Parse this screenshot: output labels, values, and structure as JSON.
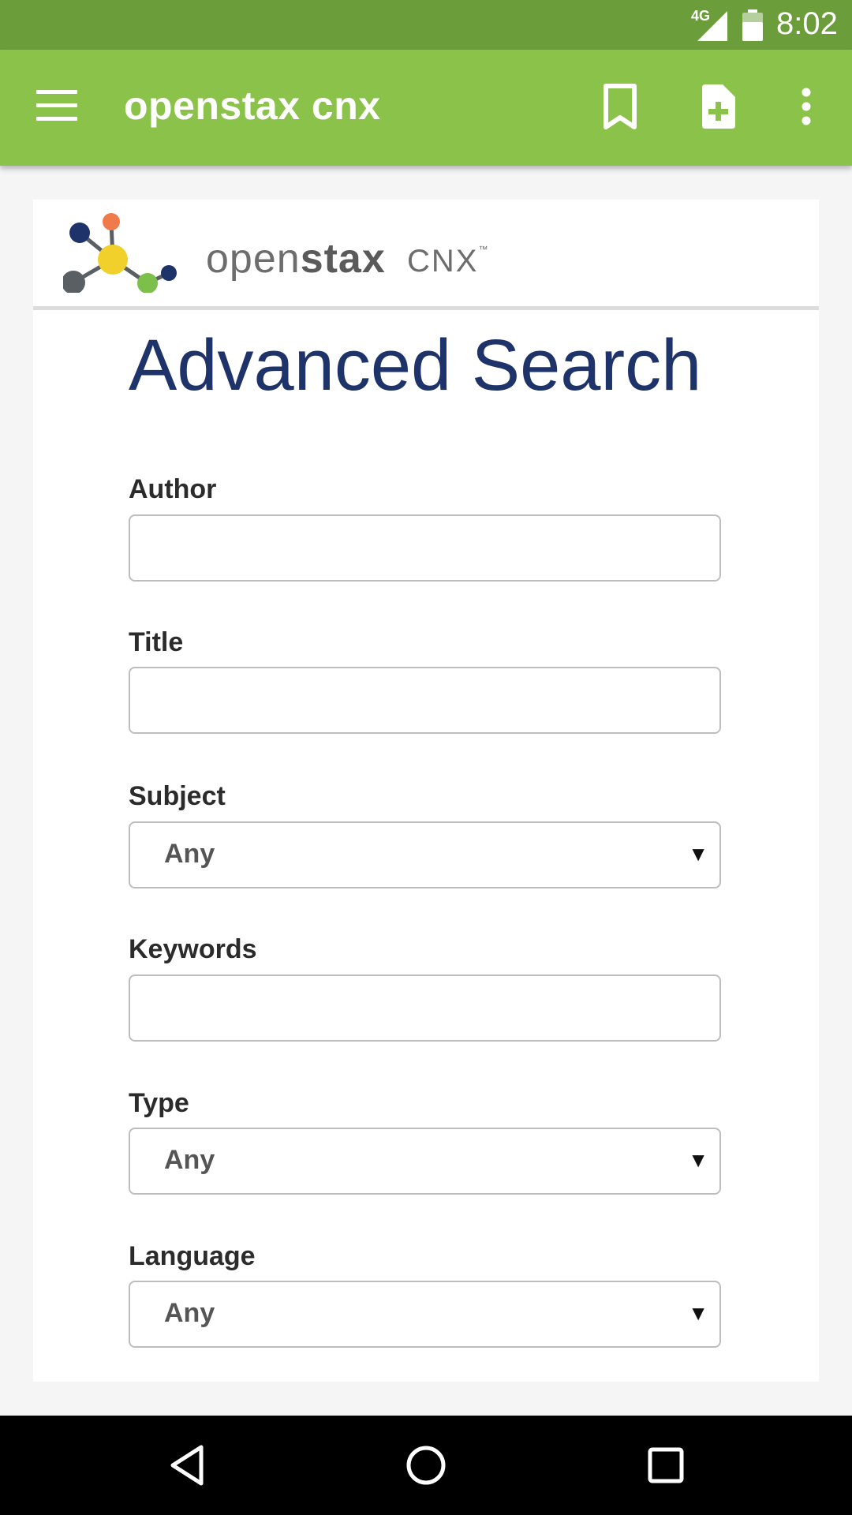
{
  "status_bar": {
    "network": "4G",
    "time": "8:02"
  },
  "app_bar": {
    "title": "openstax cnx",
    "icons": [
      "menu-icon",
      "bookmark-icon",
      "add-document-icon",
      "more-vert-icon"
    ]
  },
  "logo": {
    "brand_light": "open",
    "brand_bold": "stax",
    "product": "CNX",
    "tm": "™"
  },
  "page": {
    "title": "Advanced Search"
  },
  "form": {
    "author": {
      "label": "Author",
      "value": ""
    },
    "title": {
      "label": "Title",
      "value": ""
    },
    "subject": {
      "label": "Subject",
      "value": "Any"
    },
    "keywords": {
      "label": "Keywords",
      "value": ""
    },
    "type": {
      "label": "Type",
      "value": "Any"
    },
    "language": {
      "label": "Language",
      "value": "Any"
    },
    "dropdown_caret": "▼"
  },
  "nav_bar": {
    "icons": [
      "back-icon",
      "home-icon",
      "recents-icon"
    ]
  },
  "colors": {
    "status_bar": "#6b9e3a",
    "app_bar": "#8bc34a",
    "title_blue": "#1e3369",
    "logo_navy": "#1e3369",
    "logo_orange": "#f07a4a",
    "logo_yellow": "#f2d02c",
    "logo_green": "#7cbf4a",
    "logo_gray": "#5a5f63"
  }
}
